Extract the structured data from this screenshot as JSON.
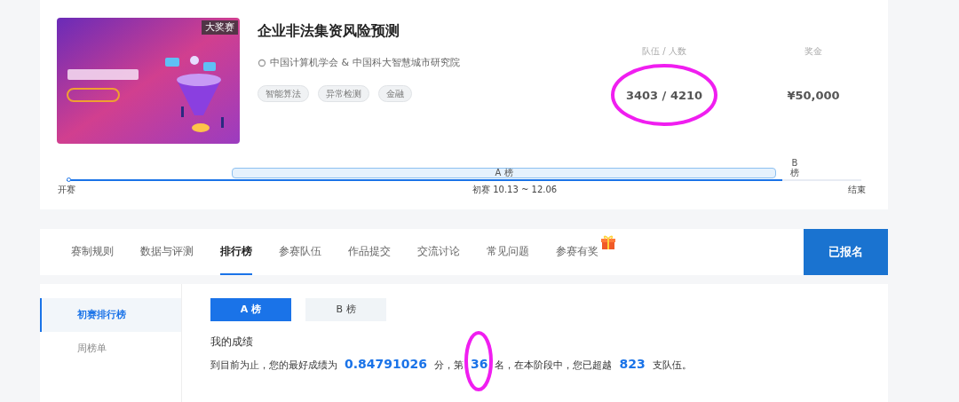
{
  "competition": {
    "badge": "大奖赛",
    "title": "企业非法集资风险预测",
    "organizers": "中国计算机学会 & 中国科大智慧城市研究院",
    "tags": [
      "智能算法",
      "异常检测",
      "金融"
    ],
    "stats": [
      {
        "label": "队伍 / 人数",
        "value": "3403 / 4210"
      },
      {
        "label": "奖金",
        "value": "¥50,000"
      }
    ]
  },
  "timeline": {
    "level": 0.9,
    "start": "开赛",
    "end": "结束",
    "stage": "初赛 10.13 ~ 12.06",
    "bars": [
      {
        "label": "A 榜",
        "kind": "wide"
      },
      {
        "label": "B 榜",
        "kind": "narrow"
      }
    ]
  },
  "tabs": [
    {
      "label": "赛制规则",
      "selected": false,
      "gift": false
    },
    {
      "label": "数据与评测",
      "selected": false,
      "gift": false
    },
    {
      "label": "排行榜",
      "selected": true,
      "gift": false
    },
    {
      "label": "参赛队伍",
      "selected": false,
      "gift": false
    },
    {
      "label": "作品提交",
      "selected": false,
      "gift": false
    },
    {
      "label": "交流讨论",
      "selected": false,
      "gift": false
    },
    {
      "label": "常见问题",
      "selected": false,
      "gift": false
    },
    {
      "label": "参赛有奖",
      "selected": false,
      "gift": true
    }
  ],
  "register_button": "已报名",
  "sidebar": [
    {
      "label": "初赛排行榜",
      "selected": true
    },
    {
      "label": "周榜单",
      "selected": false
    }
  ],
  "boards": [
    {
      "label": "A 榜",
      "selected": true
    },
    {
      "label": "B 榜",
      "selected": false
    }
  ],
  "my_score": {
    "heading": "我的成绩",
    "parts": [
      {
        "text": "到目前为止，您的最好成绩为",
        "kind": "plain"
      },
      {
        "text": "0.84791026",
        "kind": "value"
      },
      {
        "text": "分，第",
        "kind": "plain"
      },
      {
        "text": "36",
        "kind": "value"
      },
      {
        "text": "名，在本阶段中，您已超越",
        "kind": "plain"
      },
      {
        "text": "823",
        "kind": "value"
      },
      {
        "text": "支队伍。",
        "kind": "plain"
      }
    ]
  }
}
